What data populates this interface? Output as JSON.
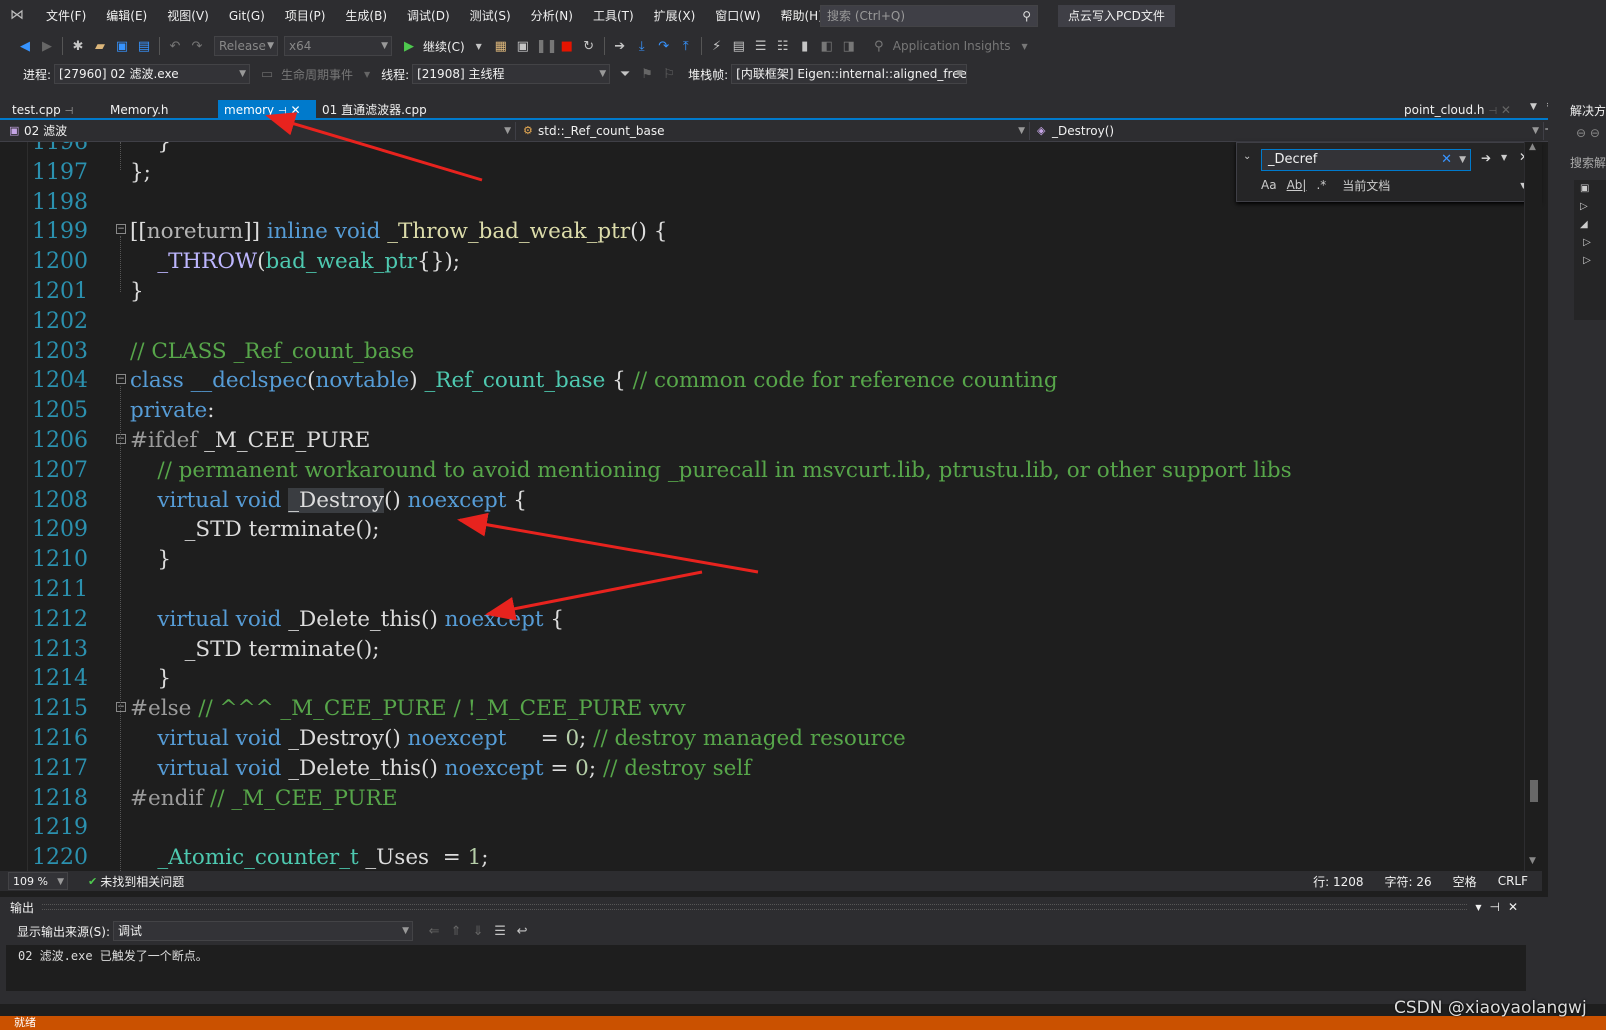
{
  "menubar": {
    "items": [
      "文件(F)",
      "编辑(E)",
      "视图(V)",
      "Git(G)",
      "项目(P)",
      "生成(B)",
      "调试(D)",
      "测试(S)",
      "分析(N)",
      "工具(T)",
      "扩展(X)",
      "窗口(W)",
      "帮助(H)"
    ],
    "search_placeholder": "搜索 (Ctrl+Q)",
    "solution_title": "点云写入PCD文件"
  },
  "toolbar": {
    "config": "Release",
    "platform": "x64",
    "continue_label": "继续(C)",
    "app_insights": "Application Insights"
  },
  "debugbar": {
    "process_label": "进程:",
    "process_value": "[27960] 02 滤波.exe",
    "lifecycle_label": "生命周期事件",
    "thread_label": "线程:",
    "thread_value": "[21908] 主线程",
    "stackframe_label": "堆栈帧:",
    "stackframe_value": "[内联框架] Eigen::internal::aligned_free"
  },
  "tabs": [
    {
      "label": "test.cpp",
      "pin": "⊣"
    },
    {
      "label": "Memory.h"
    },
    {
      "label": "memory",
      "active": true
    },
    {
      "label": "01 直通滤波器.cpp"
    }
  ],
  "tab_right": "point_cloud.h",
  "navbar": {
    "project": "02 滤波",
    "scope": "std::_Ref_count_base",
    "member": "_Destroy()"
  },
  "editor": {
    "lines": [
      {
        "n": "1196",
        "code": "    }"
      },
      {
        "n": "1197",
        "code": "};"
      },
      {
        "n": "1198",
        "code": ""
      },
      {
        "n": "1199",
        "code": "[[noreturn]] inline void _Throw_bad_weak_ptr() {"
      },
      {
        "n": "1200",
        "code": "    _THROW(bad_weak_ptr{});"
      },
      {
        "n": "1201",
        "code": "}"
      },
      {
        "n": "1202",
        "code": ""
      },
      {
        "n": "1203",
        "code": "// CLASS _Ref_count_base"
      },
      {
        "n": "1204",
        "code": "class __declspec(novtable) _Ref_count_base { // common code for reference counting"
      },
      {
        "n": "1205",
        "code": "private:"
      },
      {
        "n": "1206",
        "code": "#ifdef _M_CEE_PURE"
      },
      {
        "n": "1207",
        "code": "    // permanent workaround to avoid mentioning _purecall in msvcurt.lib, ptrustu.lib, or other support libs"
      },
      {
        "n": "1208",
        "code": "    virtual void _Destroy() noexcept {"
      },
      {
        "n": "1209",
        "code": "        _STD terminate();"
      },
      {
        "n": "1210",
        "code": "    }"
      },
      {
        "n": "1211",
        "code": ""
      },
      {
        "n": "1212",
        "code": "    virtual void _Delete_this() noexcept {"
      },
      {
        "n": "1213",
        "code": "        _STD terminate();"
      },
      {
        "n": "1214",
        "code": "    }"
      },
      {
        "n": "1215",
        "code": "#else // ^^^ _M_CEE_PURE / !_M_CEE_PURE vvv"
      },
      {
        "n": "1216",
        "code": "    virtual void _Destroy() noexcept     = 0; // destroy managed resource"
      },
      {
        "n": "1217",
        "code": "    virtual void _Delete_this() noexcept = 0; // destroy self"
      },
      {
        "n": "1218",
        "code": "#endif // _M_CEE_PURE"
      },
      {
        "n": "1219",
        "code": ""
      },
      {
        "n": "1220",
        "code": "    _Atomic_counter_t _Uses  = 1;"
      }
    ]
  },
  "find": {
    "query": "_Decref",
    "scope": "当前文档",
    "opt_case": "Aa",
    "opt_word": "Ab|",
    "opt_regex": ".*"
  },
  "editor_status": {
    "zoom": "109 %",
    "issues": "未找到相关问题",
    "line": "行: 1208",
    "col": "字符: 26",
    "ws": "空格",
    "eol": "CRLF"
  },
  "output": {
    "title": "输出",
    "source_label": "显示输出来源(S):",
    "source_value": "调试",
    "text": "02 滤波.exe 已触发了一个断点。"
  },
  "right_panel": {
    "title": "解决方",
    "search": "搜索解"
  },
  "status": {
    "ready": "就绪"
  },
  "watermark": "CSDN @xiaoyaolangwj",
  "colors": {
    "accent": "#007acc",
    "status_bar": "#ca5100",
    "arrow": "#e8231e"
  }
}
